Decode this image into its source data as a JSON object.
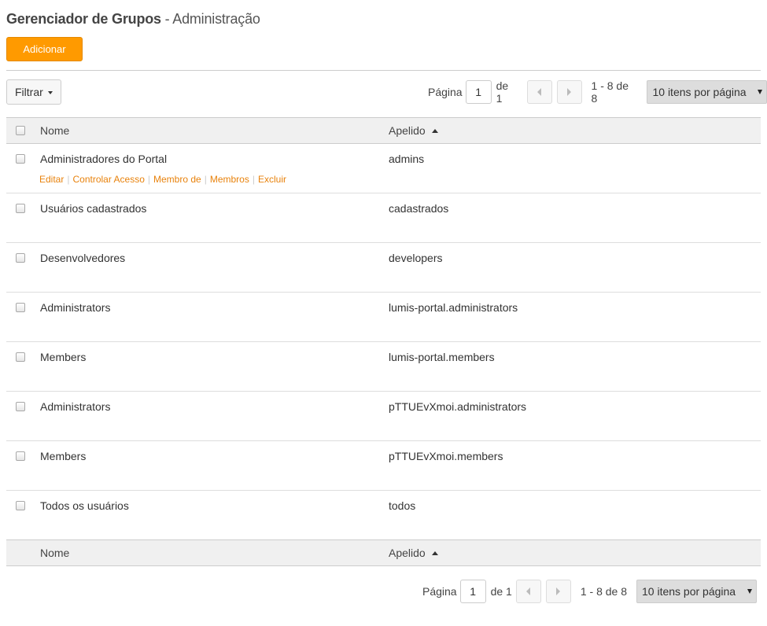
{
  "header": {
    "title_main": "Gerenciador de Grupos",
    "title_sub": " - Administração"
  },
  "toolbar": {
    "add_label": "Adicionar",
    "filter_label": "Filtrar"
  },
  "pagination": {
    "page_label": "Página",
    "page_value": "1",
    "of_label": "de 1",
    "range_label": "1 - 8 de 8",
    "per_page_label": "10 itens por página"
  },
  "table": {
    "columns": {
      "name": "Nome",
      "alias": "Apelido"
    },
    "row_actions": [
      "Editar",
      "Controlar Acesso",
      "Membro de",
      "Membros",
      "Excluir"
    ],
    "rows": [
      {
        "name": "Administradores do Portal",
        "alias": "admins"
      },
      {
        "name": "Usuários cadastrados",
        "alias": "cadastrados"
      },
      {
        "name": "Desenvolvedores",
        "alias": "developers"
      },
      {
        "name": "Administrators",
        "alias": "lumis-portal.administrators"
      },
      {
        "name": "Members",
        "alias": "lumis-portal.members"
      },
      {
        "name": "Administrators",
        "alias": "pTTUEvXmoi.administrators"
      },
      {
        "name": "Members",
        "alias": "pTTUEvXmoi.members"
      },
      {
        "name": "Todos os usuários",
        "alias": "todos"
      }
    ]
  },
  "colors": {
    "accent": "#ff9a00",
    "link": "#e8820c"
  }
}
